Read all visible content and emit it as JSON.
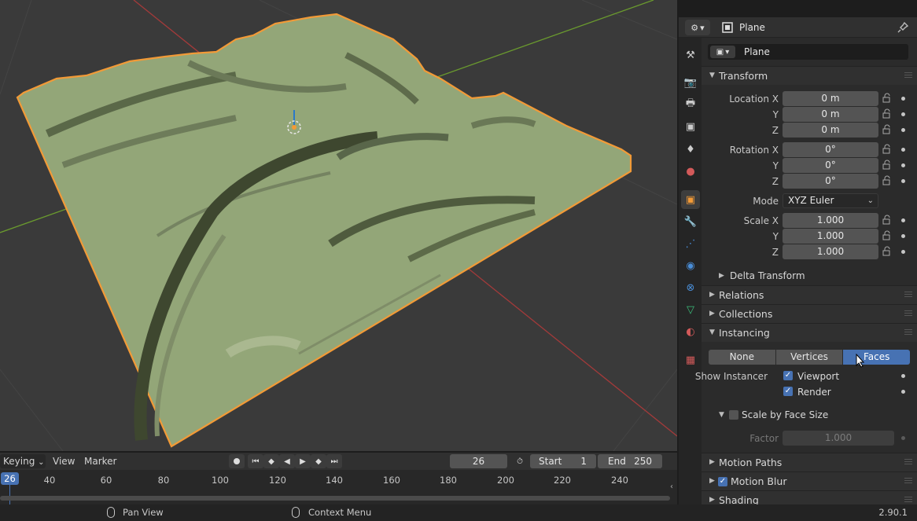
{
  "properties": {
    "header_title": "Plane",
    "object_name": "Plane",
    "tabs": [
      "tool",
      "render",
      "output",
      "view-layer",
      "scene",
      "world",
      "object",
      "modifiers",
      "particles",
      "physics",
      "constraints",
      "data",
      "material",
      "texture"
    ],
    "active_tab": "object",
    "transform": {
      "title": "Transform",
      "location_label": "Location X",
      "location": [
        "0 m",
        "0 m",
        "0 m"
      ],
      "rotation_label": "Rotation X",
      "rotation": [
        "0°",
        "0°",
        "0°"
      ],
      "y_label": "Y",
      "z_label": "Z",
      "mode_label": "Mode",
      "mode_value": "XYZ Euler",
      "scale_label": "Scale X",
      "scale": [
        "1.000",
        "1.000",
        "1.000"
      ],
      "delta_label": "Delta Transform"
    },
    "relations_label": "Relations",
    "collections_label": "Collections",
    "instancing": {
      "title": "Instancing",
      "options": [
        "None",
        "Vertices",
        "Faces"
      ],
      "selected": "Faces",
      "show_instancer_label": "Show Instancer",
      "viewport_label": "Viewport",
      "render_label": "Render",
      "scale_by_face_label": "Scale by Face Size",
      "factor_label": "Factor",
      "factor_value": "1.000"
    },
    "motion_paths_label": "Motion Paths",
    "motion_blur_label": "Motion Blur",
    "shading_label": "Shading"
  },
  "timeline": {
    "keying_label": "Keying",
    "view_label": "View",
    "marker_label": "Marker",
    "current_frame": "26",
    "start_label": "Start",
    "start_value": "1",
    "end_label": "End",
    "end_value": "250",
    "ticks": [
      "40",
      "60",
      "80",
      "100",
      "120",
      "140",
      "160",
      "180",
      "200",
      "220",
      "240"
    ]
  },
  "status": {
    "pan_view": "Pan View",
    "context_menu": "Context Menu",
    "version": "2.90.1"
  },
  "colors": {
    "accent": "#4772b3",
    "selection_outline": "#f29a37",
    "mesh": "#93a678",
    "x_axis": "#a33a3a",
    "y_axis": "#6a9a2e"
  }
}
